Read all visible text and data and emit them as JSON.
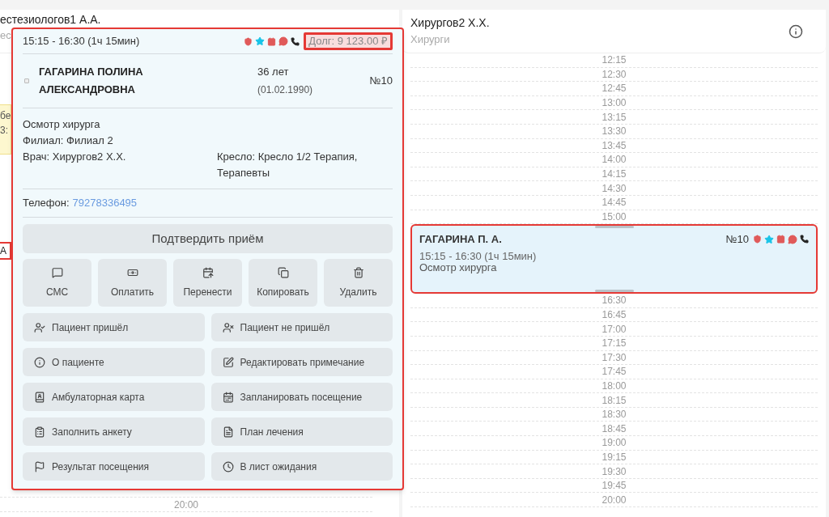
{
  "left_column": {
    "doctor": "естезиологов1 А.А.",
    "specialty": "ес",
    "cards": [
      {
        "lines": [
          "бе",
          "3:"
        ],
        "selected": false
      },
      {
        "lines": [
          "А"
        ],
        "selected": true
      }
    ],
    "times": [
      "20:00"
    ]
  },
  "popover": {
    "time": "15:15 - 16:30 (1ч 15мин)",
    "debt": "Долг: 9 123.00 ₽",
    "name": "ГАГАРИНА ПОЛИНА АЛЕКСАНДРОВНА",
    "age": "36 лет",
    "birth": "(01.02.1990)",
    "number": "№10",
    "service": "Осмотр хирурга",
    "branch": "Филиал: Филиал 2",
    "doctor": "Врач: Хирургов2 Х.Х.",
    "chair": "Кресло: Кресло 1/2 Терапия, Терапевты",
    "phone_label": "Телефон:",
    "phone": "79278336495",
    "confirm": "Подтвердить приём",
    "tiles": [
      "СМС",
      "Оплатить",
      "Перенести",
      "Копировать",
      "Удалить"
    ],
    "actions": [
      "Пациент пришёл",
      "Пациент не пришёл",
      "О пациенте",
      "Редактировать примечание",
      "Амбулаторная карта",
      "Запланировать посещение",
      "Заполнить анкету",
      "План лечения",
      "Результат посещения",
      "В лист ожидания"
    ]
  },
  "right_column": {
    "doctor": "Хирургов2 Х.Х.",
    "specialty": "Хирурги",
    "times_before": [
      "12:15",
      "12:30",
      "12:45",
      "13:00",
      "13:15",
      "13:30",
      "13:45",
      "14:00",
      "14:15",
      "14:30",
      "14:45",
      "15:00"
    ],
    "appointment": {
      "name": "ГАГАРИНА П. А.",
      "number": "№10",
      "time": "15:15 - 16:30 (1ч 15мин)",
      "service": "Осмотр хирурга",
      "selected": true
    },
    "times_after": [
      "16:30",
      "16:45",
      "17:00",
      "17:15",
      "17:30",
      "17:45",
      "18:00",
      "18:15",
      "18:30",
      "18:45",
      "19:00",
      "19:15",
      "19:30",
      "19:45",
      "20:00"
    ]
  }
}
